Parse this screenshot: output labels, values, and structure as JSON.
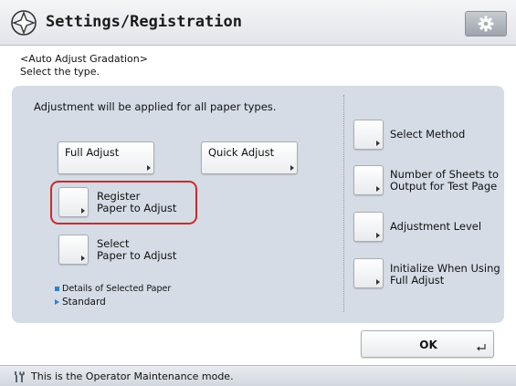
{
  "header": {
    "title": "Settings/Registration",
    "icon": "settings-registration-icon",
    "settings_button_icon": "gear-icon"
  },
  "subtitle": {
    "line1": "<Auto Adjust Gradation>",
    "line2": "Select the type."
  },
  "panel": {
    "info_text": "Adjustment will be applied for all paper types.",
    "full_adjust_label": "Full Adjust",
    "quick_adjust_label": "Quick Adjust",
    "register_paper_label": "Register\nPaper to Adjust",
    "select_paper_label": "Select\nPaper to Adjust",
    "details_label": "Details of Selected Paper",
    "selected_paper": "Standard"
  },
  "side_options": {
    "select_method": "Select Method",
    "number_of_sheets": "Number of Sheets to\nOutput for Test Page",
    "adjustment_level": "Adjustment Level",
    "initialize": "Initialize When Using\nFull Adjust"
  },
  "ok_button": {
    "label": "OK"
  },
  "footer": {
    "icon": "wrench-icon",
    "text": "This is the Operator Maintenance mode."
  },
  "colors": {
    "accent_blue": "#2f7fd1",
    "highlight_red": "#cc2a2a",
    "panel_bg": "#d5dce5"
  }
}
